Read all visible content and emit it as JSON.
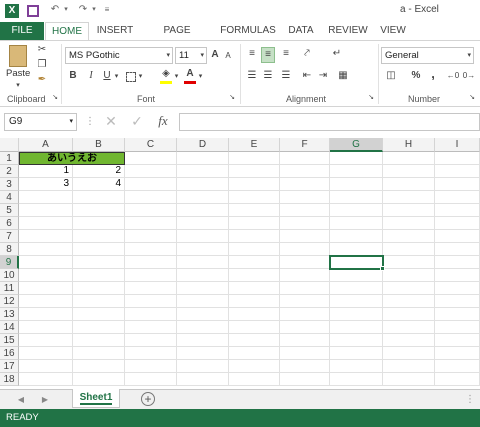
{
  "window": {
    "title": "a - Excel"
  },
  "quick_access": [
    "excel-logo-icon",
    "save-icon",
    "undo-icon",
    "redo-icon",
    "customize-icon"
  ],
  "tabs": [
    {
      "id": "file",
      "label": "FILE"
    },
    {
      "id": "home",
      "label": "HOME"
    },
    {
      "id": "insert",
      "label": "INSERT"
    },
    {
      "id": "page_layout",
      "label": "PAGE LAYOUT"
    },
    {
      "id": "formulas",
      "label": "FORMULAS"
    },
    {
      "id": "data",
      "label": "DATA"
    },
    {
      "id": "review",
      "label": "REVIEW"
    },
    {
      "id": "view",
      "label": "VIEW"
    }
  ],
  "ribbon": {
    "clipboard": {
      "label": "Clipboard",
      "paste_label": "Paste"
    },
    "font": {
      "label": "Font",
      "font_name": "MS PGothic",
      "font_size": "11",
      "bold": "B",
      "italic": "I",
      "underline": "U",
      "grow": "A",
      "shrink": "A"
    },
    "alignment": {
      "label": "Alignment"
    },
    "number": {
      "label": "Number",
      "format": "General",
      "percent": "%",
      "comma": ","
    }
  },
  "formula_bar": {
    "name_box": "G9",
    "fx": "fx",
    "value": ""
  },
  "columns": [
    "A",
    "B",
    "C",
    "D",
    "E",
    "F",
    "G",
    "H",
    "I"
  ],
  "rows": [
    "1",
    "2",
    "3",
    "4",
    "5",
    "6",
    "7",
    "8",
    "9",
    "10",
    "11",
    "12",
    "13",
    "14",
    "15",
    "16",
    "17",
    "18"
  ],
  "cells": {
    "A1": "あいうえお",
    "A2": "1",
    "B2": "2",
    "A3": "3",
    "B3": "4"
  },
  "accent": {
    "excel_green": "#217346",
    "header_fill": "#70b630"
  },
  "sheets": [
    {
      "label": "Sheet1"
    }
  ],
  "status": {
    "text": "READY"
  }
}
